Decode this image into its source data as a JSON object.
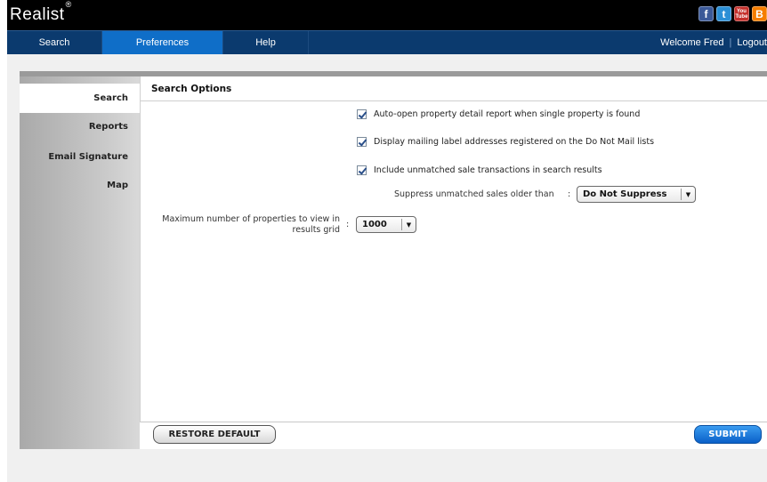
{
  "app": {
    "logo_text": "Realist",
    "logo_mark": "®"
  },
  "social": {
    "facebook": "f",
    "twitter": "t",
    "youtube_top": "You",
    "youtube_bottom": "Tube",
    "blogger": "B"
  },
  "nav": {
    "tabs": [
      {
        "label": "Search"
      },
      {
        "label": "Preferences"
      },
      {
        "label": "Help"
      }
    ],
    "active_tab": "Preferences",
    "welcome": "Welcome Fred",
    "separator": "|",
    "logout": "Logout"
  },
  "sidebar": {
    "items": [
      {
        "label": "Search"
      },
      {
        "label": "Reports"
      },
      {
        "label": "Email Signature"
      },
      {
        "label": "Map"
      }
    ],
    "active_item": "Search"
  },
  "panel": {
    "title": "Search Options",
    "options": [
      {
        "label": "Auto-open property detail report when single property is found",
        "checked": true
      },
      {
        "label": "Display mailing label addresses registered on the Do Not Mail lists",
        "checked": true
      },
      {
        "label": "Include unmatched sale transactions in search results",
        "checked": true
      }
    ],
    "suppress": {
      "label": "Suppress unmatched sales older than",
      "colon": ":",
      "value": "Do Not Suppress"
    },
    "max_props": {
      "label_line1": "Maximum number of properties to view in",
      "label_line2": "results grid",
      "colon": ":",
      "value": "1000"
    }
  },
  "buttons": {
    "restore": "RESTORE DEFAULT",
    "submit": "SUBMIT"
  },
  "icons": {
    "dropdown": "▼"
  },
  "colors": {
    "topbar": "#000000",
    "navbar": "#0b3a6e",
    "nav_active": "#0f6ec8",
    "submit": "#0a60c8"
  }
}
